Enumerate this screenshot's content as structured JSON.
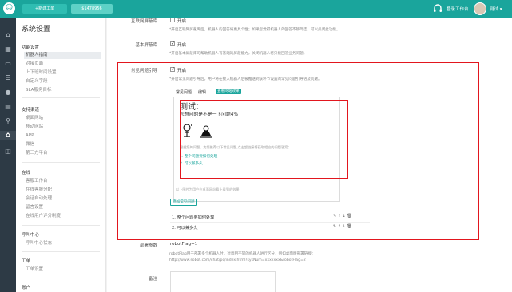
{
  "header": {
    "tabs": [
      "+新建工单",
      "$1478956"
    ],
    "workspace_label": "登录工作台",
    "username": "测试"
  },
  "sidebar": {
    "title": "系统设置",
    "sections": [
      {
        "label": "功能设置",
        "items": [
          "机器人指南",
          "对接页面",
          "上下班时间设置",
          "自定义字段",
          "SLA服务目标"
        ]
      },
      {
        "label": "支持渠道",
        "items": [
          "桌面网站",
          "移动网站",
          "APP",
          "微信",
          "第三方平台"
        ]
      },
      {
        "label": "在线",
        "items": [
          "客服工作台",
          "在线客服分配",
          "会话自动处理",
          "留言设置",
          "在线用户评分制度"
        ]
      },
      {
        "label": "呼叫中心",
        "items": [
          "呼叫中心状态"
        ]
      },
      {
        "label": "工单",
        "items": [
          "工单设置"
        ]
      },
      {
        "label": "账户",
        "items": []
      }
    ],
    "active_item": "机器人指南"
  },
  "settings": {
    "row1": {
      "label": "互联网屏蔽库",
      "cb_label": "开启",
      "checked": false,
      "hint": "*开启互联网屏蔽库后，机器人的回答将更具个性；如果您觉得机器人的回答不够简洁，可以关闭此功能。"
    },
    "row2": {
      "label": "基本屏蔽库",
      "cb_label": "开启",
      "checked": true,
      "hint": "*开启基本屏蔽库可帮助机器人有基础的屏蔽能力，关闭机器人将只能回答业务问题。"
    },
    "row3": {
      "label": "常见问题引导",
      "cb_label": "开启",
      "checked": true,
      "hint": "*开启常见问题引导后，用户将在接入机器人后被推送到该环节设置的常见问题引导语及问题。",
      "tabs": [
        "常见问题",
        "编辑"
      ],
      "tab_btn": "查看网站效果",
      "preview": {
        "title": "测试：",
        "question": "您想问的是不是一下问题4%",
        "note": "根据您的问题，为您推荐以下常见问题,点击超链接将获取相应的问题答案：",
        "links": [
          "1. 整个问题要如何处理",
          "2. 可以兼多久"
        ]
      },
      "caption": "以上图片为用户在桌面网站看上看到的效果",
      "add_btn": "添加常见问题",
      "questions": [
        "1. 整个问题要如何处理",
        "2. 可以兼多久"
      ]
    },
    "row4": {
      "label": "部署参数",
      "value": "robotFlag=1",
      "hint1": "robotFlag用于部署多个机器人时，对调用不同的机器人进行区分，例如桌面版部署链接：",
      "hint2": "http://www.sobot.com/chat/pc/index.html?sysNum=xxxxxxx&robotFlag=2"
    },
    "row5": {
      "label": "备注"
    }
  },
  "colors": {
    "brand": "#1aa59c",
    "highlight": "#e2161e",
    "rail": "#2d3a45"
  }
}
